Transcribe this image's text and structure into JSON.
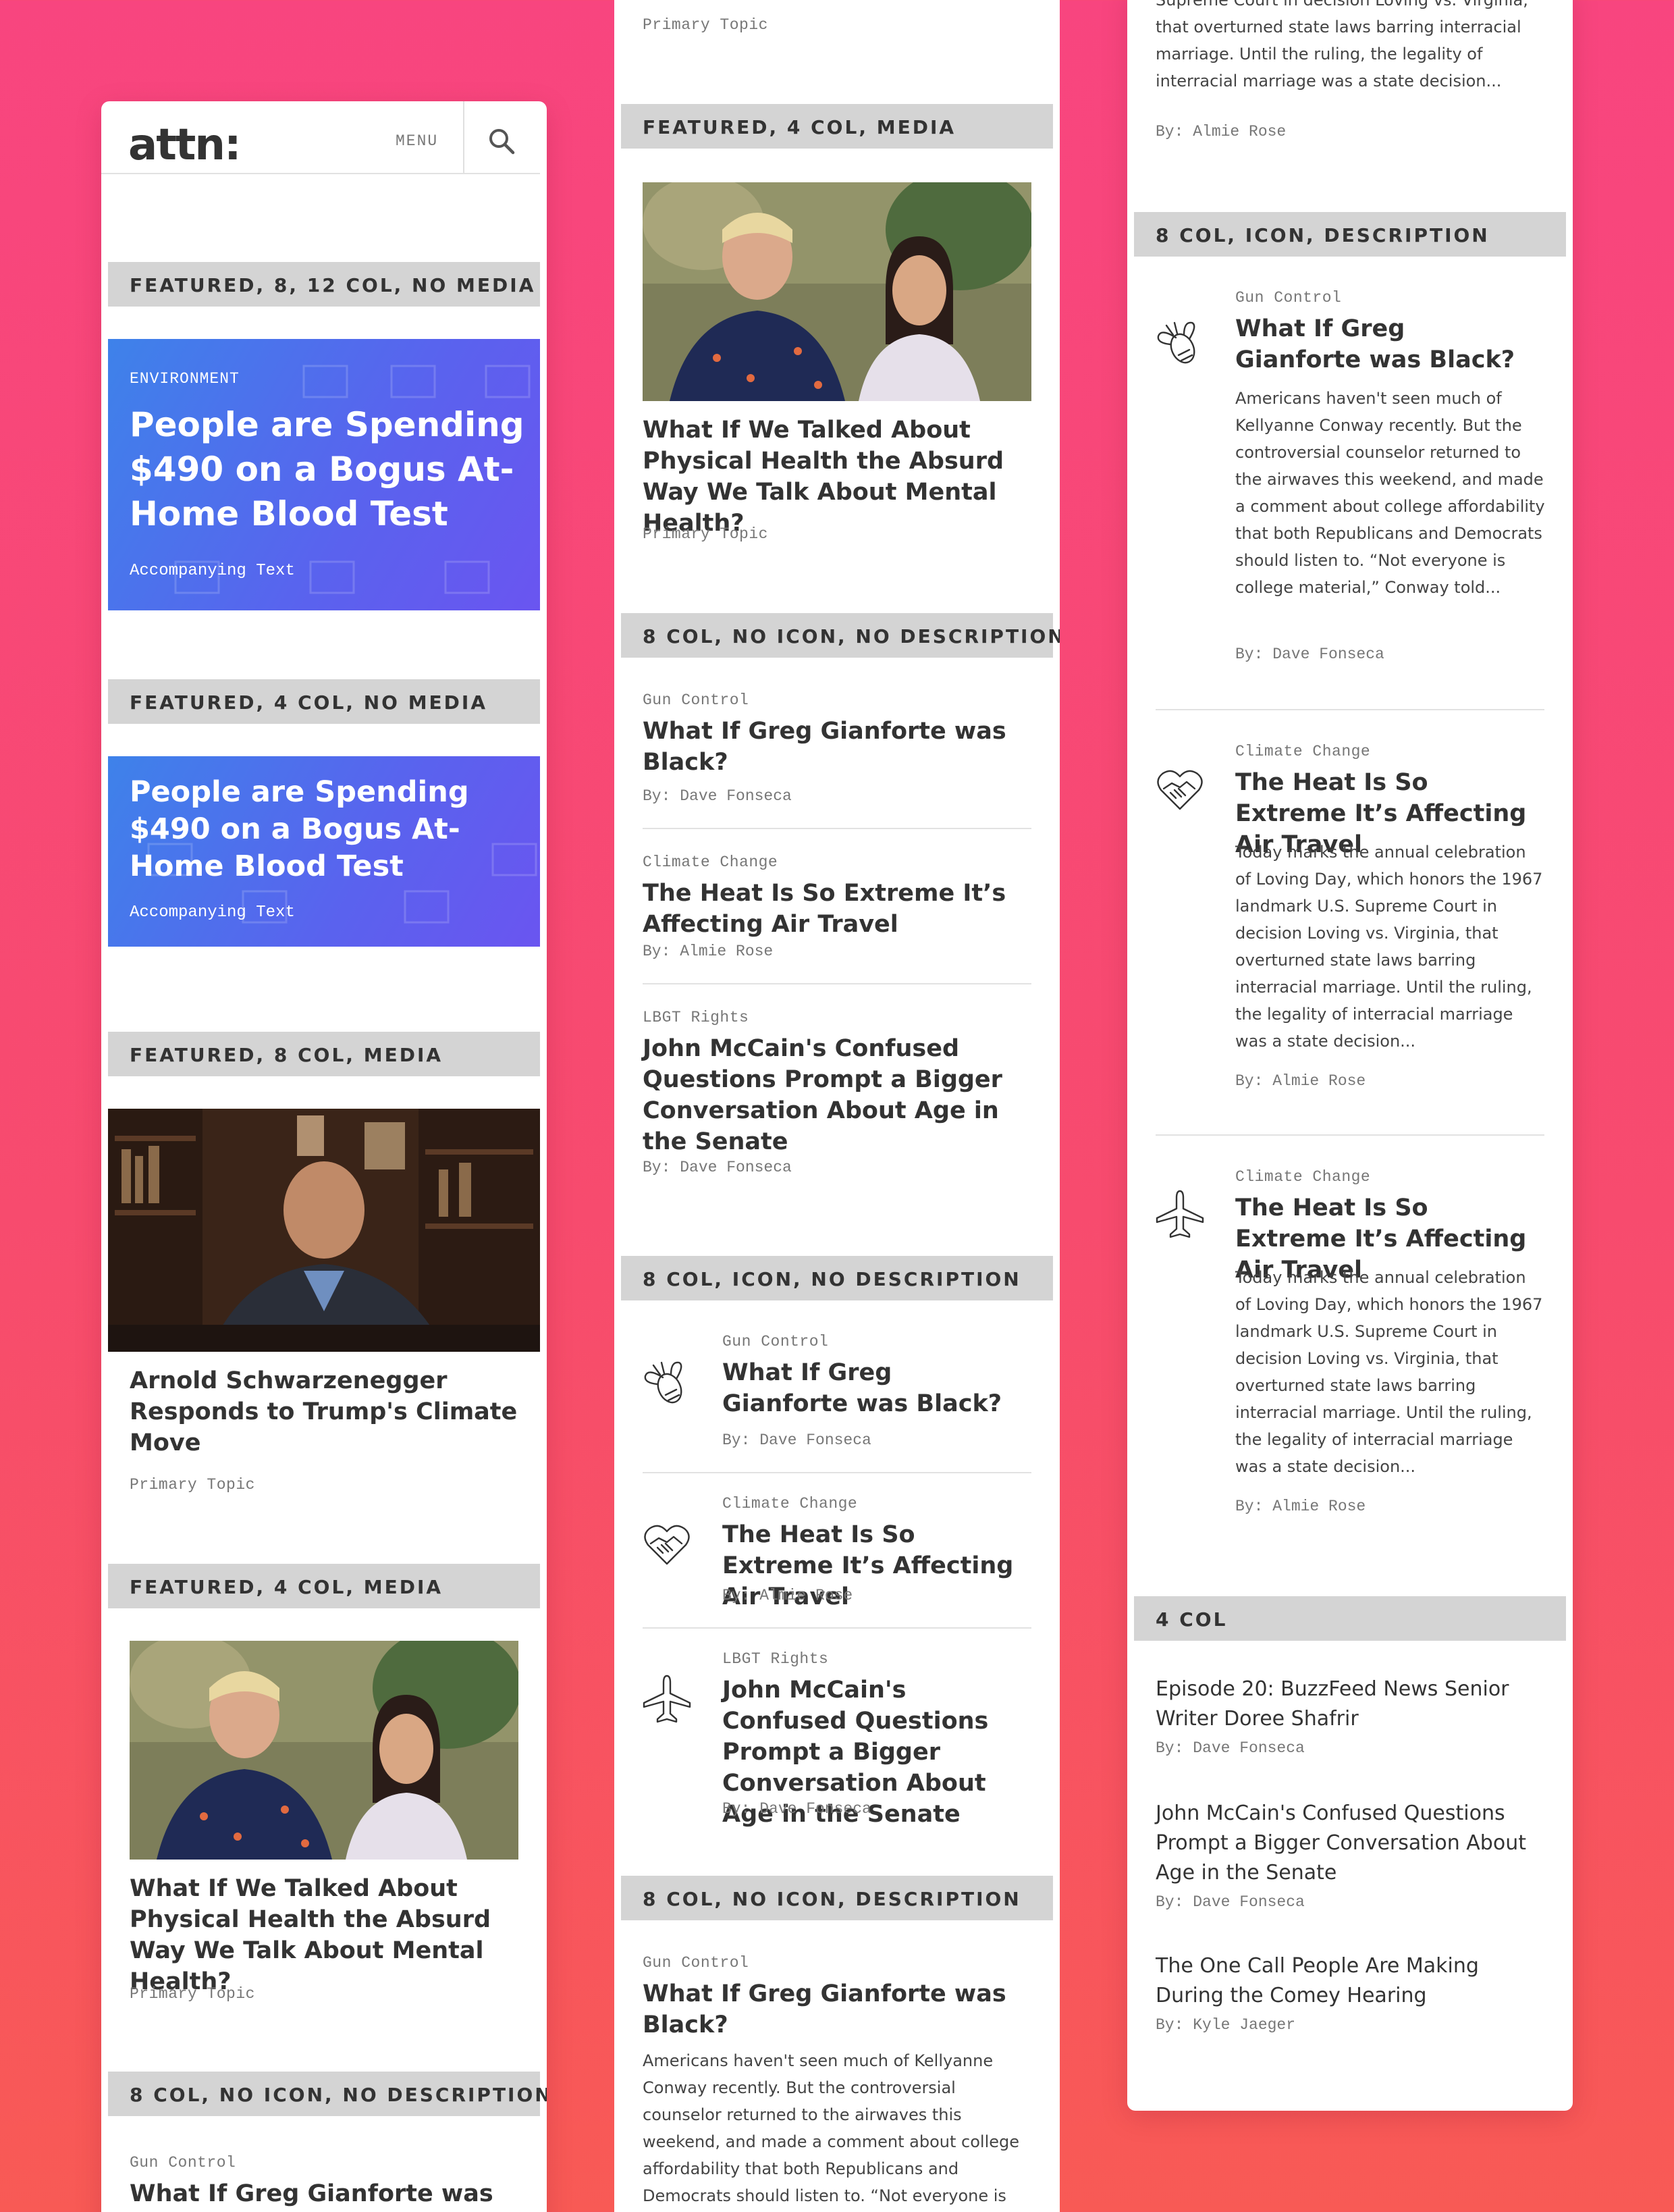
{
  "col1": {
    "logo": "attn:",
    "menu_label": "MENU",
    "sec_featured_8_12": "FEATURED, 8, 12 COL, NO MEDIA",
    "hero1": {
      "kicker": "ENVIRONMENT",
      "title": "People are Spending $490 on a Bogus At-Home Blood Test",
      "accompanying": "Accompanying Text"
    },
    "sec_featured_4_nomedia": "FEATURED, 4 COL, NO MEDIA",
    "hero2": {
      "title": "People are Spending $490 on a Bogus At-Home Blood Test",
      "accompanying": "Accompanying Text"
    },
    "sec_featured_8_media": "FEATURED, 8 COL, MEDIA",
    "card_arnold": {
      "title": "Arnold Schwarzenegger Responds to Trump's Climate Move",
      "topic": "Primary Topic"
    },
    "sec_featured_4_media": "FEATURED, 4 COL, MEDIA",
    "card_health": {
      "title": "What If We Talked About Physical Health the Absurd Way We Talk About Mental Health?",
      "topic": "Primary Topic"
    },
    "sec_8_noicon_nodesc": "8 COL, NO ICON, NO DESCRIPTION",
    "partial": {
      "topic": "Gun Control",
      "title": "What If Greg Gianforte was Black?"
    }
  },
  "col2": {
    "top_topic": "Primary Topic",
    "sec_featured_4_media": "FEATURED, 4 COL, MEDIA",
    "card_health": {
      "title": "What If We Talked About Physical Health the Absurd Way We Talk About Mental Health?",
      "topic": "Primary Topic"
    },
    "sec_8_noicon_nodesc": "8 COL, NO ICON, NO DESCRIPTION",
    "list_a": [
      {
        "topic": "Gun Control",
        "title": "What If Greg Gianforte was Black?",
        "byline": "By: Dave Fonseca"
      },
      {
        "topic": "Climate Change",
        "title": "The Heat Is So Extreme It’s Affecting Air Travel",
        "byline": "By: Almie Rose"
      },
      {
        "topic": "LBGT Rights",
        "title": "John McCain's Confused Questions Prompt a Bigger Conversation About Age in the Senate",
        "byline": "By: Dave Fonseca"
      }
    ],
    "sec_8_icon_nodesc": "8 COL, ICON, NO DESCRIPTION",
    "list_b": [
      {
        "icon": "firefly-icon",
        "topic": "Gun Control",
        "title": "What If Greg Gianforte was Black?",
        "byline": "By: Dave Fonseca"
      },
      {
        "icon": "handshake-heart-icon",
        "topic": "Climate Change",
        "title": "The Heat Is So Extreme It’s Affecting Air Travel",
        "byline": "By: Almie Rose"
      },
      {
        "icon": "airplane-icon",
        "topic": "LBGT Rights",
        "title": "John McCain's Confused Questions Prompt a Bigger Conversation About Age in the Senate",
        "byline": "By: Dave Fonseca"
      }
    ],
    "sec_8_noicon_desc": "8 COL, NO ICON, DESCRIPTION",
    "desc_item": {
      "topic": "Gun Control",
      "title": "What If Greg Gianforte was Black?",
      "desc": "Americans haven't seen much of Kellyanne Conway recently. But the controversial counselor returned to the airwaves this weekend, and made a comment about college affordability that both Republicans and Democrats should listen to. “Not everyone is"
    }
  },
  "col3": {
    "top_desc": "Supreme Court in decision Loving vs. Virginia, that overturned state laws barring interracial marriage. Until the ruling, the legality of interracial marriage was a state decision...",
    "top_byline": "By: Almie Rose",
    "sec_8_icon_desc": "8 COL, ICON, DESCRIPTION",
    "list_c": [
      {
        "icon": "firefly-icon",
        "topic": "Gun Control",
        "title": "What If Greg Gianforte was Black?",
        "desc": "Americans haven't seen much of Kellyanne Conway recently. But the controversial counselor returned to the airwaves this weekend, and made a comment about college affordability that both Republicans and Democrats should listen to. “Not everyone is college material,” Conway told...",
        "byline": "By: Dave Fonseca"
      },
      {
        "icon": "handshake-heart-icon",
        "topic": "Climate Change",
        "title": "The Heat Is So Extreme It’s Affecting Air Travel",
        "desc": "Today marks the annual celebration of Loving Day, which honors the 1967 landmark U.S. Supreme Court in decision Loving vs. Virginia, that overturned state laws barring interracial marriage. Until the ruling, the legality of interracial marriage was a state decision...",
        "byline": "By: Almie Rose"
      },
      {
        "icon": "airplane-icon",
        "topic": "Climate Change",
        "title": "The Heat Is So Extreme It’s Affecting Air Travel",
        "desc": "Today marks the annual celebration of Loving Day, which honors the 1967 landmark U.S. Supreme Court in decision Loving vs. Virginia, that overturned state laws barring interracial marriage. Until the ruling, the legality of interracial marriage was a state decision...",
        "byline": "By: Almie Rose"
      }
    ],
    "sec_4col": "4 COL",
    "list_d": [
      {
        "title": "Episode 20: BuzzFeed News Senior Writer Doree Shafrir",
        "byline": "By: Dave Fonseca"
      },
      {
        "title": "John McCain's Confused Questions Prompt a Bigger Conversation About Age in the Senate",
        "byline": "By: Dave Fonseca"
      },
      {
        "title": "The One Call People Are Making During the Comey Hearing",
        "byline": "By: Kyle Jaeger"
      }
    ]
  },
  "colors": {
    "background": "#f8457f",
    "hero": "#4f6ff0",
    "section_bar": "#d4d4d4",
    "text": "#333333"
  }
}
